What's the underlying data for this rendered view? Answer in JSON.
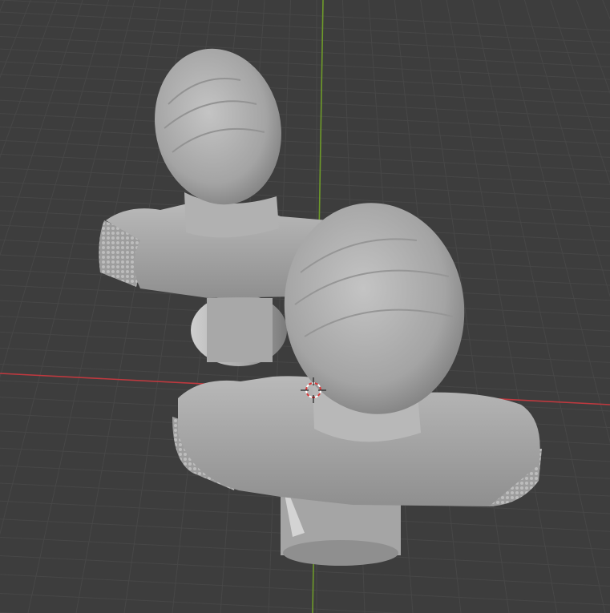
{
  "viewport": {
    "view": "3d-viewport",
    "background": "#3d3d3d",
    "grid_color": "#474747",
    "x_axis_color": "#c0393f",
    "y_axis_color": "#6e9a2a",
    "cursor_icon": "3d-cursor-icon"
  },
  "scene": {
    "objects": [
      {
        "name_icon": "bust-mesh-icon",
        "color": "#a9a9a9"
      },
      {
        "name_icon": "bust-mesh-icon",
        "color": "#a9a9a9"
      }
    ]
  }
}
